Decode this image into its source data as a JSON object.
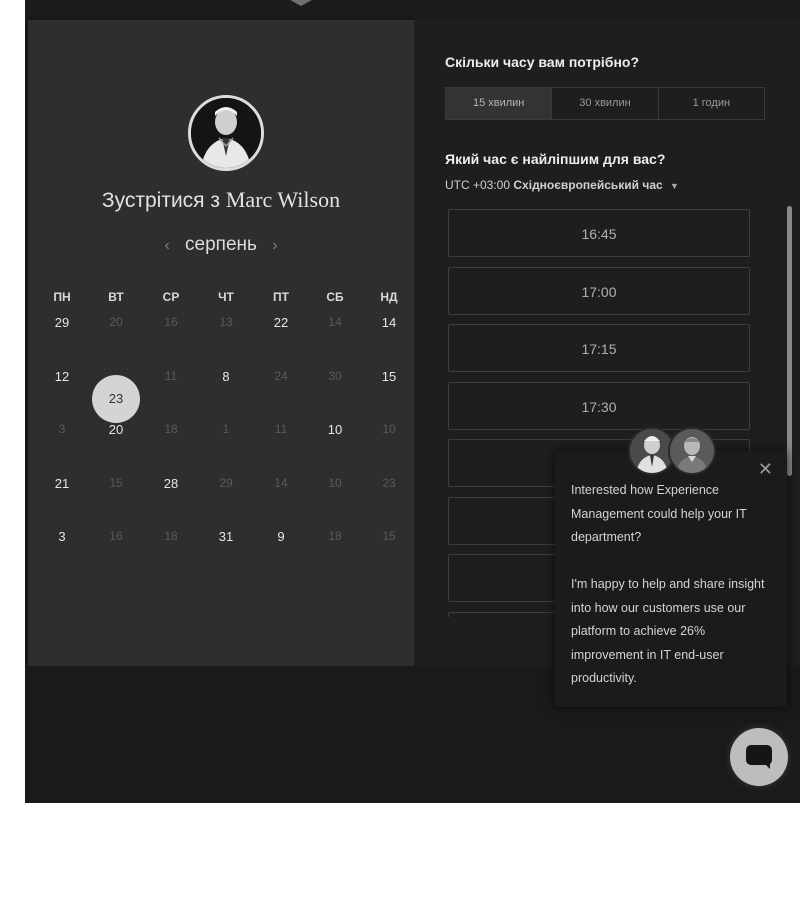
{
  "host": {
    "prefix": "Зустрітися з",
    "name": "Marc Wilson"
  },
  "calendar": {
    "month": "серпень",
    "weekdays": [
      "ПН",
      "ВТ",
      "СР",
      "ЧТ",
      "ПТ",
      "СБ",
      "НД"
    ],
    "weeks": [
      [
        {
          "d": "29",
          "muted": false
        },
        {
          "d": "20",
          "muted": true
        },
        {
          "d": "16",
          "muted": true
        },
        {
          "d": "13",
          "muted": true
        },
        {
          "d": "22",
          "muted": false
        },
        {
          "d": "14",
          "muted": true
        },
        {
          "d": "14",
          "muted": false
        }
      ],
      [
        {
          "d": "12",
          "muted": false
        },
        {
          "d": "23",
          "muted": false,
          "selected": true
        },
        {
          "d": "11",
          "muted": true
        },
        {
          "d": "8",
          "muted": false
        },
        {
          "d": "24",
          "muted": true
        },
        {
          "d": "30",
          "muted": true
        },
        {
          "d": "15",
          "muted": false
        }
      ],
      [
        {
          "d": "3",
          "muted": true
        },
        {
          "d": "20",
          "muted": false
        },
        {
          "d": "18",
          "muted": true
        },
        {
          "d": "1",
          "muted": true
        },
        {
          "d": "11",
          "muted": true
        },
        {
          "d": "10",
          "muted": false
        },
        {
          "d": "10",
          "muted": true
        }
      ],
      [
        {
          "d": "21",
          "muted": false
        },
        {
          "d": "15",
          "muted": true
        },
        {
          "d": "28",
          "muted": false
        },
        {
          "d": "29",
          "muted": true
        },
        {
          "d": "14",
          "muted": true
        },
        {
          "d": "10",
          "muted": true
        },
        {
          "d": "23",
          "muted": true
        }
      ],
      [
        {
          "d": "3",
          "muted": false
        },
        {
          "d": "16",
          "muted": true
        },
        {
          "d": "18",
          "muted": true
        },
        {
          "d": "31",
          "muted": false
        },
        {
          "d": "9",
          "muted": false
        },
        {
          "d": "18",
          "muted": true
        },
        {
          "d": "15",
          "muted": true
        }
      ]
    ]
  },
  "duration": {
    "question": "Скільки часу вам потрібно?",
    "options": [
      "15 хвилин",
      "30 хвилин",
      "1 годин"
    ],
    "selected_index": 0
  },
  "timeslots": {
    "question": "Який час є найліпшим для вас?",
    "tz_offset": "UTC +03:00",
    "tz_name": "Східноєвропейський час",
    "slots": [
      "16:45",
      "17:00",
      "17:15",
      "17:30",
      "",
      "",
      "",
      ""
    ]
  },
  "popup": {
    "paragraph1": "Interested how Experience Management could help your IT department?",
    "paragraph2": "I'm happy to help and share insight into how our customers use our platform to achieve 26% improvement in IT end-user productivity.",
    "close_glyph": "✕"
  },
  "icons": {
    "prev_month": "chevron-left-icon",
    "next_month": "chevron-right-icon",
    "timezone_dropdown": "caret-down-icon",
    "close": "close-icon",
    "chat": "chat-bubble-icon"
  },
  "colors": {
    "background": "#1c1c1c",
    "calendar_panel": "#2e2e2e",
    "selected_day": "#d4d4d4",
    "chat_button": "#bdbdbd"
  }
}
